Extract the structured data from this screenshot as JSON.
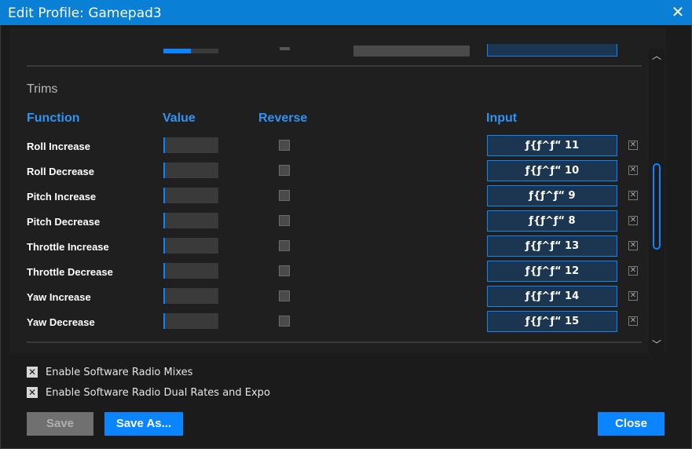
{
  "window": {
    "title": "Edit Profile: Gamepad3",
    "close_glyph": "✕"
  },
  "trims": {
    "section_title": "Trims",
    "columns": {
      "function": "Function",
      "value": "Value",
      "reverse": "Reverse",
      "input": "Input"
    },
    "rows": [
      {
        "function": "Roll Increase",
        "input": "ƒ{ƒ^ƒ“ 11",
        "reverse": false
      },
      {
        "function": "Roll Decrease",
        "input": "ƒ{ƒ^ƒ“ 10",
        "reverse": false
      },
      {
        "function": "Pitch Increase",
        "input": "ƒ{ƒ^ƒ“ 9",
        "reverse": false
      },
      {
        "function": "Pitch Decrease",
        "input": "ƒ{ƒ^ƒ“ 8",
        "reverse": false
      },
      {
        "function": "Throttle Increase",
        "input": "ƒ{ƒ^ƒ“ 13",
        "reverse": false
      },
      {
        "function": "Throttle Decrease",
        "input": "ƒ{ƒ^ƒ“ 12",
        "reverse": false
      },
      {
        "function": "Yaw Increase",
        "input": "ƒ{ƒ^ƒ“ 14",
        "reverse": false
      },
      {
        "function": "Yaw Decrease",
        "input": "ƒ{ƒ^ƒ“ 15",
        "reverse": false
      }
    ],
    "clear_glyph": "✕"
  },
  "options": {
    "radio_mixes": {
      "label": "Enable Software Radio Mixes",
      "checked": true,
      "glyph": "✕"
    },
    "dual_rates": {
      "label": "Enable Software Radio Dual Rates and Expo",
      "checked": true,
      "glyph": "✕"
    }
  },
  "buttons": {
    "save": "Save",
    "save_as": "Save As...",
    "close": "Close"
  },
  "scrollbar": {
    "up_glyph": "︿",
    "down_glyph": "﹀",
    "position": 0.55
  },
  "colors": {
    "accent": "#0a84ff",
    "title_bar": "#0a7fd6",
    "header_text": "#2f94f3",
    "background": "#1b1b1b"
  }
}
